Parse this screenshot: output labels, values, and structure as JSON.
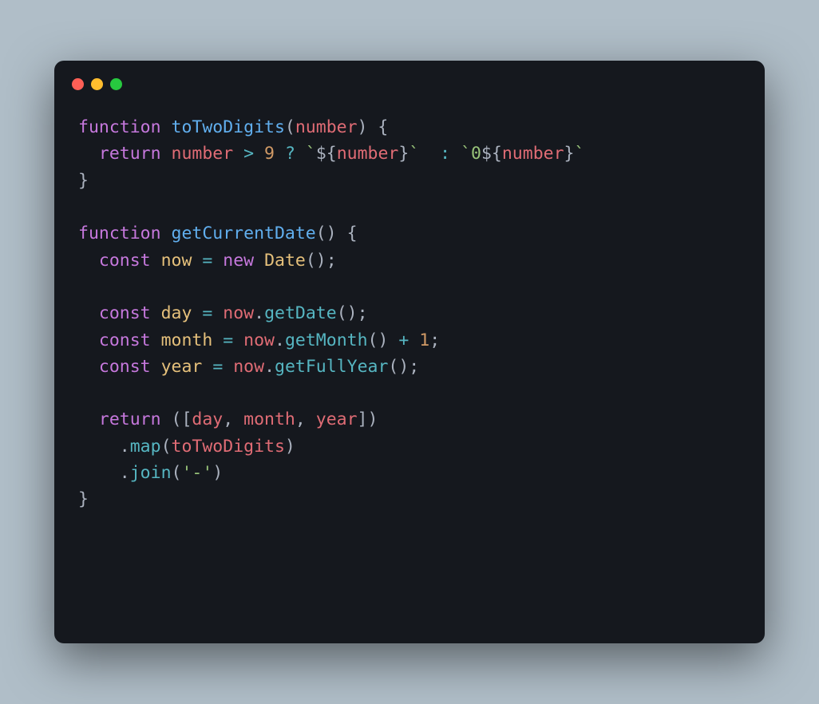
{
  "window": {
    "traffic_lights": [
      "close",
      "minimize",
      "maximize"
    ]
  },
  "code": {
    "lines": [
      [
        {
          "cls": "tok-keyword",
          "t": "function"
        },
        {
          "cls": "",
          "t": " "
        },
        {
          "cls": "tok-func",
          "t": "toTwoDigits"
        },
        {
          "cls": "tok-punct",
          "t": "("
        },
        {
          "cls": "tok-param",
          "t": "number"
        },
        {
          "cls": "tok-punct",
          "t": ") {"
        }
      ],
      [
        {
          "cls": "",
          "t": "  "
        },
        {
          "cls": "tok-keyword",
          "t": "return"
        },
        {
          "cls": "",
          "t": " "
        },
        {
          "cls": "tok-prop",
          "t": "number"
        },
        {
          "cls": "",
          "t": " "
        },
        {
          "cls": "tok-operator",
          "t": ">"
        },
        {
          "cls": "",
          "t": " "
        },
        {
          "cls": "tok-number",
          "t": "9"
        },
        {
          "cls": "",
          "t": " "
        },
        {
          "cls": "tok-operator",
          "t": "?"
        },
        {
          "cls": "",
          "t": " "
        },
        {
          "cls": "tok-template",
          "t": "`"
        },
        {
          "cls": "tok-interp-braces",
          "t": "${"
        },
        {
          "cls": "tok-interp",
          "t": "number"
        },
        {
          "cls": "tok-interp-braces",
          "t": "}"
        },
        {
          "cls": "tok-template",
          "t": "`"
        },
        {
          "cls": "",
          "t": "  "
        },
        {
          "cls": "tok-operator",
          "t": ":"
        },
        {
          "cls": "",
          "t": " "
        },
        {
          "cls": "tok-template",
          "t": "`0"
        },
        {
          "cls": "tok-interp-braces",
          "t": "${"
        },
        {
          "cls": "tok-interp",
          "t": "number"
        },
        {
          "cls": "tok-interp-braces",
          "t": "}"
        },
        {
          "cls": "tok-template",
          "t": "`"
        }
      ],
      [
        {
          "cls": "tok-punct",
          "t": "}"
        }
      ],
      [
        {
          "cls": "",
          "t": ""
        }
      ],
      [
        {
          "cls": "tok-keyword",
          "t": "function"
        },
        {
          "cls": "",
          "t": " "
        },
        {
          "cls": "tok-func",
          "t": "getCurrentDate"
        },
        {
          "cls": "tok-punct",
          "t": "() {"
        }
      ],
      [
        {
          "cls": "",
          "t": "  "
        },
        {
          "cls": "tok-keyword",
          "t": "const"
        },
        {
          "cls": "",
          "t": " "
        },
        {
          "cls": "tok-var",
          "t": "now"
        },
        {
          "cls": "",
          "t": " "
        },
        {
          "cls": "tok-operator",
          "t": "="
        },
        {
          "cls": "",
          "t": " "
        },
        {
          "cls": "tok-keyword",
          "t": "new"
        },
        {
          "cls": "",
          "t": " "
        },
        {
          "cls": "tok-class",
          "t": "Date"
        },
        {
          "cls": "tok-punct",
          "t": "();"
        }
      ],
      [
        {
          "cls": "",
          "t": ""
        }
      ],
      [
        {
          "cls": "",
          "t": "  "
        },
        {
          "cls": "tok-keyword",
          "t": "const"
        },
        {
          "cls": "",
          "t": " "
        },
        {
          "cls": "tok-var",
          "t": "day"
        },
        {
          "cls": "",
          "t": " "
        },
        {
          "cls": "tok-operator",
          "t": "="
        },
        {
          "cls": "",
          "t": " "
        },
        {
          "cls": "tok-prop",
          "t": "now"
        },
        {
          "cls": "tok-punct",
          "t": "."
        },
        {
          "cls": "tok-method",
          "t": "getDate"
        },
        {
          "cls": "tok-punct",
          "t": "();"
        }
      ],
      [
        {
          "cls": "",
          "t": "  "
        },
        {
          "cls": "tok-keyword",
          "t": "const"
        },
        {
          "cls": "",
          "t": " "
        },
        {
          "cls": "tok-var",
          "t": "month"
        },
        {
          "cls": "",
          "t": " "
        },
        {
          "cls": "tok-operator",
          "t": "="
        },
        {
          "cls": "",
          "t": " "
        },
        {
          "cls": "tok-prop",
          "t": "now"
        },
        {
          "cls": "tok-punct",
          "t": "."
        },
        {
          "cls": "tok-method",
          "t": "getMonth"
        },
        {
          "cls": "tok-punct",
          "t": "() "
        },
        {
          "cls": "tok-operator",
          "t": "+"
        },
        {
          "cls": "",
          "t": " "
        },
        {
          "cls": "tok-number",
          "t": "1"
        },
        {
          "cls": "tok-punct",
          "t": ";"
        }
      ],
      [
        {
          "cls": "",
          "t": "  "
        },
        {
          "cls": "tok-keyword",
          "t": "const"
        },
        {
          "cls": "",
          "t": " "
        },
        {
          "cls": "tok-var",
          "t": "year"
        },
        {
          "cls": "",
          "t": " "
        },
        {
          "cls": "tok-operator",
          "t": "="
        },
        {
          "cls": "",
          "t": " "
        },
        {
          "cls": "tok-prop",
          "t": "now"
        },
        {
          "cls": "tok-punct",
          "t": "."
        },
        {
          "cls": "tok-method",
          "t": "getFullYear"
        },
        {
          "cls": "tok-punct",
          "t": "();"
        }
      ],
      [
        {
          "cls": "",
          "t": ""
        }
      ],
      [
        {
          "cls": "",
          "t": "  "
        },
        {
          "cls": "tok-keyword",
          "t": "return"
        },
        {
          "cls": "",
          "t": " "
        },
        {
          "cls": "tok-punct",
          "t": "(["
        },
        {
          "cls": "tok-prop",
          "t": "day"
        },
        {
          "cls": "tok-punct",
          "t": ", "
        },
        {
          "cls": "tok-prop",
          "t": "month"
        },
        {
          "cls": "tok-punct",
          "t": ", "
        },
        {
          "cls": "tok-prop",
          "t": "year"
        },
        {
          "cls": "tok-punct",
          "t": "])"
        }
      ],
      [
        {
          "cls": "",
          "t": "    "
        },
        {
          "cls": "tok-punct",
          "t": "."
        },
        {
          "cls": "tok-method",
          "t": "map"
        },
        {
          "cls": "tok-punct",
          "t": "("
        },
        {
          "cls": "tok-prop",
          "t": "toTwoDigits"
        },
        {
          "cls": "tok-punct",
          "t": ")"
        }
      ],
      [
        {
          "cls": "",
          "t": "    "
        },
        {
          "cls": "tok-punct",
          "t": "."
        },
        {
          "cls": "tok-method",
          "t": "join"
        },
        {
          "cls": "tok-punct",
          "t": "("
        },
        {
          "cls": "tok-string",
          "t": "'-'"
        },
        {
          "cls": "tok-punct",
          "t": ")"
        }
      ],
      [
        {
          "cls": "tok-punct",
          "t": "}"
        }
      ]
    ]
  }
}
